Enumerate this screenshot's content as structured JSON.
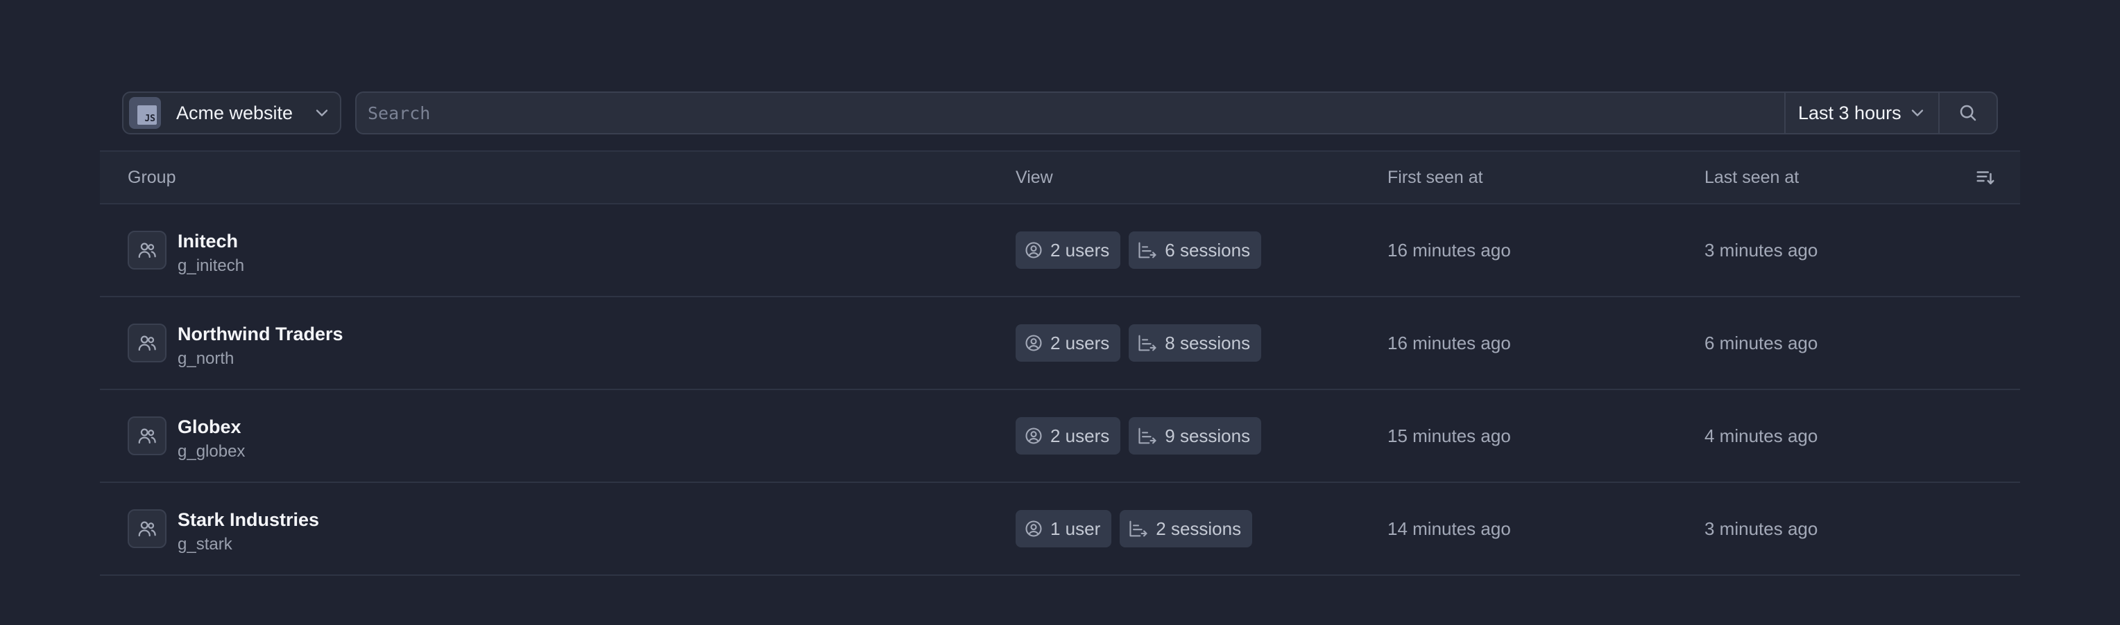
{
  "toolbar": {
    "project_badge": "JS",
    "project_label": "Acme website",
    "search_placeholder": "Search",
    "time_range_label": "Last 3 hours"
  },
  "table": {
    "headers": {
      "group": "Group",
      "view": "View",
      "first_seen": "First seen at",
      "last_seen": "Last seen at"
    },
    "rows": [
      {
        "name": "Initech",
        "id": "g_initech",
        "users": "2 users",
        "sessions": "6 sessions",
        "first_seen": "16 minutes ago",
        "last_seen": "3 minutes ago"
      },
      {
        "name": "Northwind Traders",
        "id": "g_north",
        "users": "2 users",
        "sessions": "8 sessions",
        "first_seen": "16 minutes ago",
        "last_seen": "6 minutes ago"
      },
      {
        "name": "Globex",
        "id": "g_globex",
        "users": "2 users",
        "sessions": "9 sessions",
        "first_seen": "15 minutes ago",
        "last_seen": "4 minutes ago"
      },
      {
        "name": "Stark Industries",
        "id": "g_stark",
        "users": "1 user",
        "sessions": "2 sessions",
        "first_seen": "14 minutes ago",
        "last_seen": "3 minutes ago"
      }
    ]
  },
  "icons": {
    "project": "js-icon",
    "chevron": "chevron-down-icon",
    "search": "search-icon",
    "sort": "sort-icon",
    "group": "users-group-icon",
    "user": "user-circle-icon",
    "sessions": "sessions-icon"
  },
  "colors": {
    "background": "#1f2331",
    "header_bg": "#232836",
    "chip_bg": "#333a4b",
    "border": "#3a4050"
  }
}
